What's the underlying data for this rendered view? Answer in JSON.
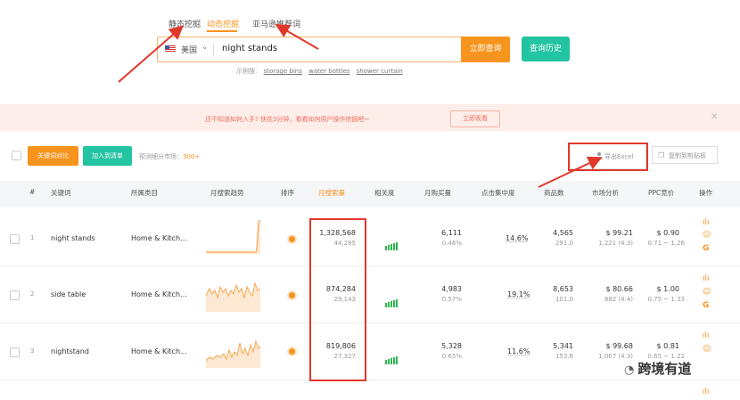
{
  "tabs": [
    "静态挖掘",
    "动态挖掘",
    "亚马逊推荐词"
  ],
  "search": {
    "country": "美国",
    "query": "night stands",
    "submit": "立即查询",
    "history": "查询历史"
  },
  "examples": {
    "label": "示例搜:",
    "items": [
      "storage bins",
      "water bottles",
      "shower curtain"
    ]
  },
  "banner": {
    "text": "还不知道如何入手? 快花3分钟，看看如何用户操作挖掘吧~",
    "button": "立即观看",
    "close": "✕"
  },
  "toolbar": {
    "keyword_btn": "关键词对比",
    "add_list": "加入到清单",
    "market_prefix": "预测细分市场：",
    "market_count": "300+",
    "export": "导出Excel",
    "copy": "复制到剪贴板"
  },
  "columns": [
    "#",
    "关键词",
    "所属类目",
    "月搜索趋势",
    "排序",
    "月搜索量",
    "相关度",
    "月购买量",
    "点击集中度",
    "商品数",
    "市场分析",
    "PPC竞价",
    "操作"
  ],
  "rows": [
    {
      "num": "1",
      "keyword": "night stands",
      "category": "Home & Kitch...",
      "search": "1,328,568",
      "search_sub": "44,285",
      "purchase": "6,111",
      "purchase_pct": "0.46%",
      "conc": "14.6%",
      "products": "4,565",
      "products_sub": "291.0",
      "price": "$ 99.21",
      "reviews": "1,221 (4.3)",
      "ppc": "$ 0.90",
      "ppc_range": "0.71 ~ 1.26"
    },
    {
      "num": "2",
      "keyword": "side table",
      "category": "Home & Kitch...",
      "search": "874,284",
      "search_sub": "29,143",
      "purchase": "4,983",
      "purchase_pct": "0.57%",
      "conc": "19.1%",
      "products": "8,653",
      "products_sub": "101.0",
      "price": "$ 80.66",
      "reviews": "882 (4.4)",
      "ppc": "$ 1.00",
      "ppc_range": "0.75 ~ 1.33"
    },
    {
      "num": "3",
      "keyword": "nightstand",
      "category": "Home & Kitch...",
      "search": "819,806",
      "search_sub": "27,327",
      "purchase": "5,328",
      "purchase_pct": "0.65%",
      "conc": "11.6%",
      "products": "5,341",
      "products_sub": "153.6",
      "price": "$ 99.68",
      "reviews": "1,067 (4.3)",
      "ppc": "$ 0.81",
      "ppc_range": "0.65 ~ 1.22"
    }
  ],
  "watermark": "跨境有道",
  "colors": {
    "accent": "#f7941d",
    "green": "#23c4a1",
    "annotation": "#e0382b"
  }
}
